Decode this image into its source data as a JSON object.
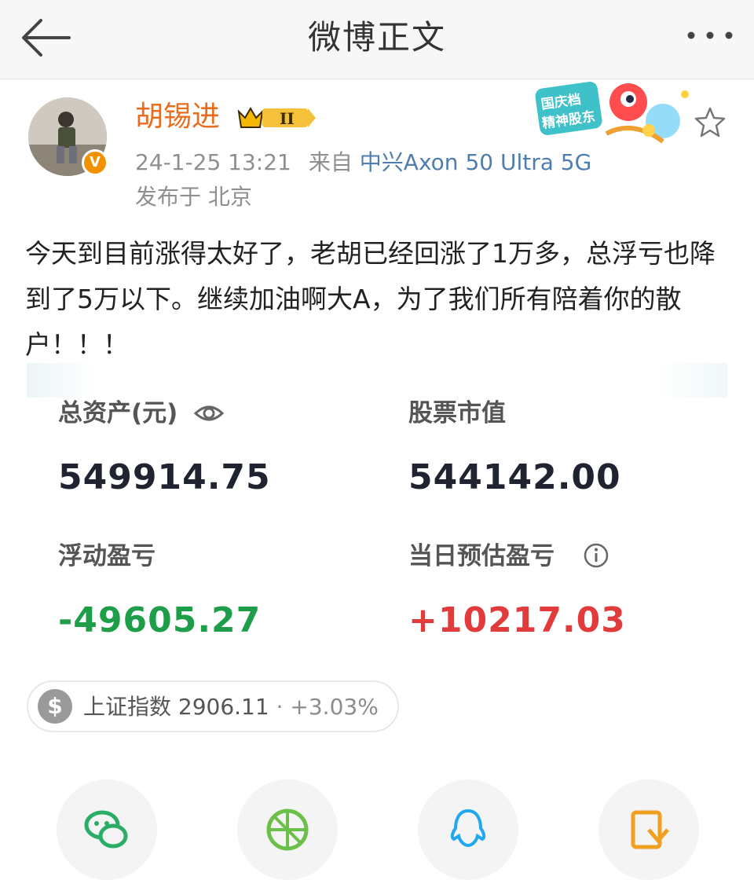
{
  "header": {
    "title": "微博正文"
  },
  "author": {
    "name": "胡锡进",
    "badge_level": "II",
    "timestamp": "24-1-25 13:21",
    "source_prefix": "来自",
    "device": "中兴Axon 50 Ultra 5G",
    "location": "发布于 北京",
    "promo_text": "国庆档 精神股东"
  },
  "post": {
    "text": "今天到目前涨得太好了，老胡已经回涨了1万多，总浮亏也降到了5万以下。继续加油啊大A，为了我们所有陪着你的散户！！！"
  },
  "account_card": {
    "total_assets_label": "总资产(元)",
    "total_assets_value": "549914.75",
    "stock_value_label": "股票市值",
    "stock_value_value": "544142.00",
    "floating_pl_label": "浮动盈亏",
    "floating_pl_value": "-49605.27",
    "daily_pl_label": "当日预估盈亏",
    "daily_pl_value": "+10217.03"
  },
  "index_pill": {
    "icon": "$",
    "text": "上证指数 2906.11",
    "change": "· +3.03%"
  },
  "share_icons": [
    "wechat-icon",
    "moments-icon",
    "qq-icon",
    "qzone-icon"
  ],
  "colors": {
    "username": "#ea6c1e",
    "device_link": "#507daf",
    "loss": "#1f9e4a",
    "gain": "#e23b3b"
  }
}
